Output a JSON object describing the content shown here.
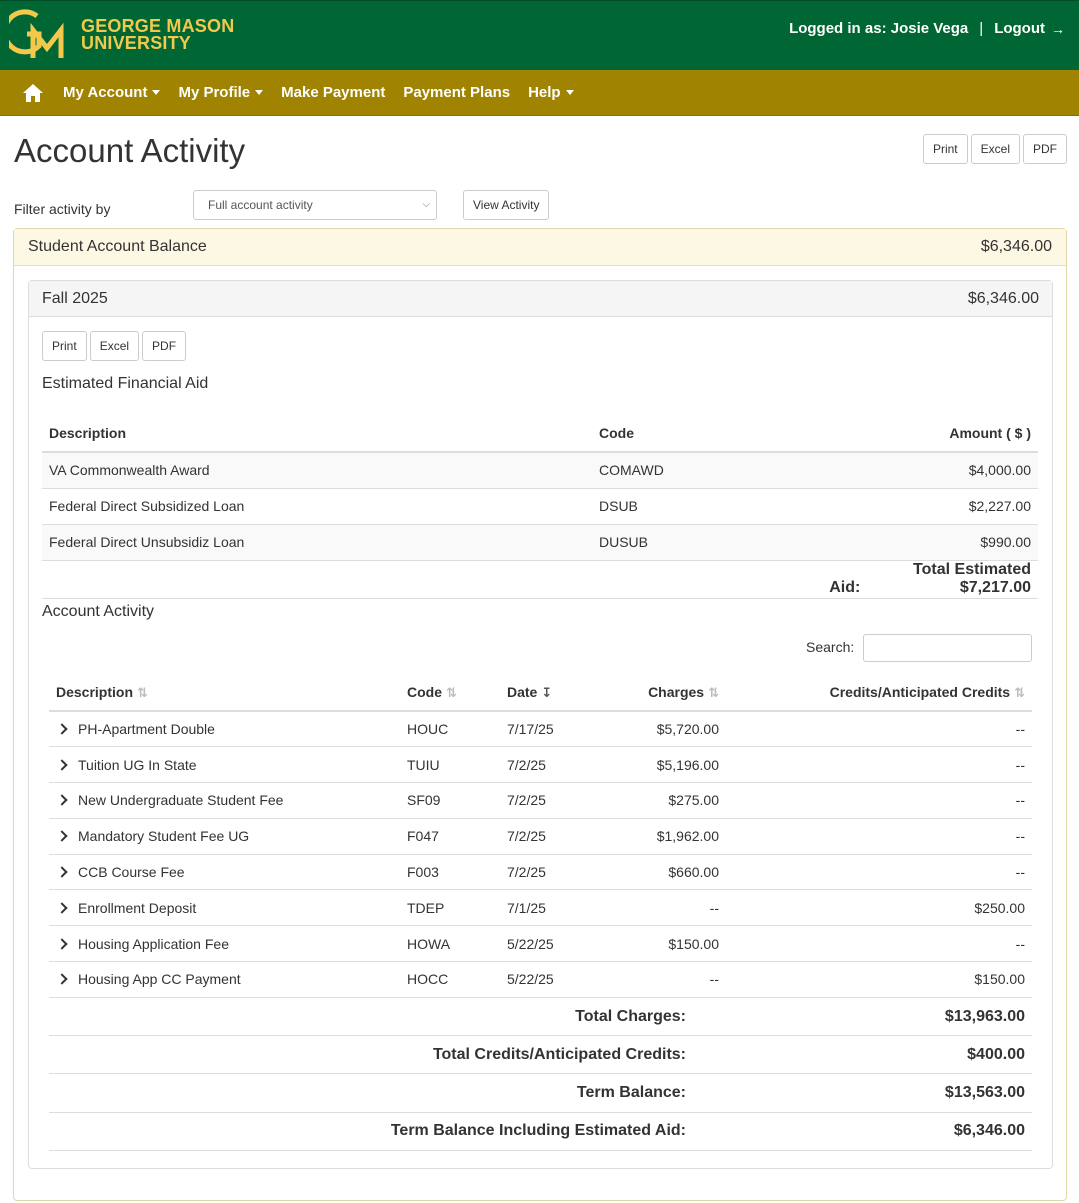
{
  "header": {
    "logo_line1": "GEORGE MASON",
    "logo_line2": "UNIVERSITY",
    "logo_mark": "GM",
    "logged_in_text": "Logged in as: Josie Vega",
    "separator": "|",
    "logout_label": "Logout",
    "logout_icon": "sign-out-icon"
  },
  "nav": {
    "home_icon": "home-icon",
    "items": [
      {
        "label": "My Account",
        "dropdown": true
      },
      {
        "label": "My Profile",
        "dropdown": true
      },
      {
        "label": "Make Payment",
        "dropdown": false
      },
      {
        "label": "Payment Plans",
        "dropdown": false
      },
      {
        "label": "Help",
        "dropdown": true
      }
    ]
  },
  "page": {
    "title": "Account Activity",
    "export_buttons": [
      "Print",
      "Excel",
      "PDF"
    ],
    "filter_label": "Filter activity by",
    "filter_selected": "Full account activity",
    "view_button": "View Activity"
  },
  "balance": {
    "label": "Student Account Balance",
    "amount": "$6,346.00"
  },
  "term": {
    "label": "Fall 2025",
    "amount": "$6,346.00",
    "export_buttons": [
      "Print",
      "Excel",
      "PDF"
    ],
    "aid_title": "Estimated Financial Aid",
    "aid_headers": [
      "Description",
      "Code",
      "Amount ( $ )"
    ],
    "aid_rows": [
      {
        "description": "VA Commonwealth Award",
        "code": "COMAWD",
        "amount": "$4,000.00"
      },
      {
        "description": "Federal Direct Subsidized Loan",
        "code": "DSUB",
        "amount": "$2,227.00"
      },
      {
        "description": "Federal Direct Unsubsidiz Loan",
        "code": "DUSUB",
        "amount": "$990.00"
      }
    ],
    "aid_total_label": "Total Estimated Aid:",
    "aid_total": "$7,217.00",
    "activity_title": "Account Activity",
    "search_label": "Search:",
    "search_value": "",
    "activity_headers": [
      "Description",
      "Code",
      "Date",
      "Charges",
      "Credits/Anticipated Credits"
    ],
    "activity_rows": [
      {
        "description": "PH-Apartment Double",
        "code": "HOUC",
        "date": "7/17/25",
        "charges": "$5,720.00",
        "credits": "--"
      },
      {
        "description": "Tuition UG In State",
        "code": "TUIU",
        "date": "7/2/25",
        "charges": "$5,196.00",
        "credits": "--"
      },
      {
        "description": "New Undergraduate Student Fee",
        "code": "SF09",
        "date": "7/2/25",
        "charges": "$275.00",
        "credits": "--"
      },
      {
        "description": "Mandatory Student Fee UG",
        "code": "F047",
        "date": "7/2/25",
        "charges": "$1,962.00",
        "credits": "--"
      },
      {
        "description": "CCB Course Fee",
        "code": "F003",
        "date": "7/2/25",
        "charges": "$660.00",
        "credits": "--"
      },
      {
        "description": "Enrollment Deposit",
        "code": "TDEP",
        "date": "7/1/25",
        "charges": "--",
        "credits": "$250.00"
      },
      {
        "description": "Housing Application Fee",
        "code": "HOWA",
        "date": "5/22/25",
        "charges": "$150.00",
        "credits": "--"
      },
      {
        "description": "Housing App CC Payment",
        "code": "HOCC",
        "date": "5/22/25",
        "charges": "--",
        "credits": "$150.00"
      }
    ],
    "totals": [
      {
        "label": "Total Charges:",
        "value": "$13,963.00"
      },
      {
        "label": "Total Credits/Anticipated Credits:",
        "value": "$400.00"
      },
      {
        "label": "Term Balance:",
        "value": "$13,563.00"
      },
      {
        "label": "Term Balance Including Estimated Aid:",
        "value": "$6,346.00"
      }
    ]
  },
  "colors": {
    "header_green": "#006633",
    "nav_gold": "#a08300",
    "logo_gold": "#f2c94c",
    "balance_bg": "#fcf8e3"
  }
}
